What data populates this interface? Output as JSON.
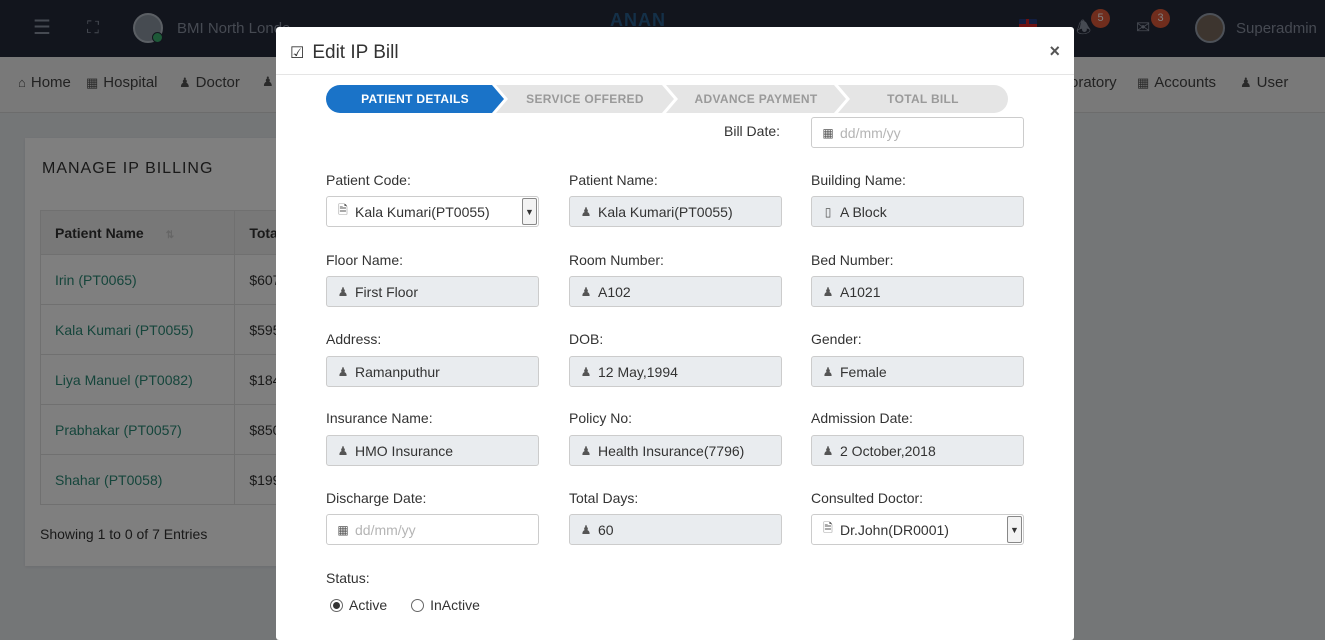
{
  "topbar": {
    "hospital_name": "BMI North Londo",
    "brand": "ANAN",
    "notifications_count": "5",
    "messages_count": "3",
    "user_name": "Superadmin"
  },
  "nav": {
    "items": [
      {
        "label": "Home",
        "icon": "home-icon"
      },
      {
        "label": "Hospital",
        "icon": "hospital-icon"
      },
      {
        "label": "Doctor",
        "icon": "doctor-icon"
      },
      {
        "label": "oratory",
        "icon": "laboratory-icon"
      },
      {
        "label": "Accounts",
        "icon": "calculator-icon"
      },
      {
        "label": "User",
        "icon": "user-plus-icon"
      }
    ]
  },
  "background_card": {
    "title": "MANAGE IP BILLING",
    "columns": [
      "Patient Name",
      "Tota"
    ],
    "rows": [
      {
        "name": "Irin (PT0065)",
        "total": "$607"
      },
      {
        "name": "Kala Kumari (PT0055)",
        "total": "$595"
      },
      {
        "name": "Liya Manuel (PT0082)",
        "total": "$184"
      },
      {
        "name": "Prabhakar (PT0057)",
        "total": "$850"
      },
      {
        "name": "Shahar (PT0058)",
        "total": "$199"
      }
    ],
    "showing": "Showing 1 to 0 of 7 Entries"
  },
  "modal": {
    "title": "Edit IP Bill",
    "close": "×",
    "steps": [
      "PATIENT DETAILS",
      "SERVICE OFFERED",
      "ADVANCE PAYMENT",
      "TOTAL BILL"
    ],
    "active_step": "PATIENT DETAILS",
    "bill_date": {
      "label": "Bill Date:",
      "placeholder": "dd/mm/yy"
    },
    "patient_code": {
      "label": "Patient Code:",
      "value": "Kala Kumari(PT0055)"
    },
    "patient_name": {
      "label": "Patient Name:",
      "value": "Kala Kumari(PT0055)"
    },
    "building_name": {
      "label": "Building Name:",
      "value": "A Block"
    },
    "floor_name": {
      "label": "Floor Name:",
      "value": "First Floor"
    },
    "room_number": {
      "label": "Room Number:",
      "value": "A102"
    },
    "bed_number": {
      "label": "Bed Number:",
      "value": "A1021"
    },
    "address": {
      "label": "Address:",
      "value": "Ramanputhur"
    },
    "dob": {
      "label": "DOB:",
      "value": "12 May,1994"
    },
    "gender": {
      "label": "Gender:",
      "value": "Female"
    },
    "insurance_name": {
      "label": "Insurance Name:",
      "value": "HMO Insurance"
    },
    "policy_no": {
      "label": "Policy No:",
      "value": "Health Insurance(7796)"
    },
    "admission_date": {
      "label": "Admission Date:",
      "value": "2 October,2018"
    },
    "discharge_date": {
      "label": "Discharge Date:",
      "placeholder": "dd/mm/yy"
    },
    "total_days": {
      "label": "Total Days:",
      "value": "60"
    },
    "consulted_doctor": {
      "label": "Consulted Doctor:",
      "value": "Dr.John(DR0001)"
    },
    "status": {
      "label": "Status:",
      "options": [
        "Active",
        "InActive"
      ],
      "selected": "Active"
    }
  }
}
